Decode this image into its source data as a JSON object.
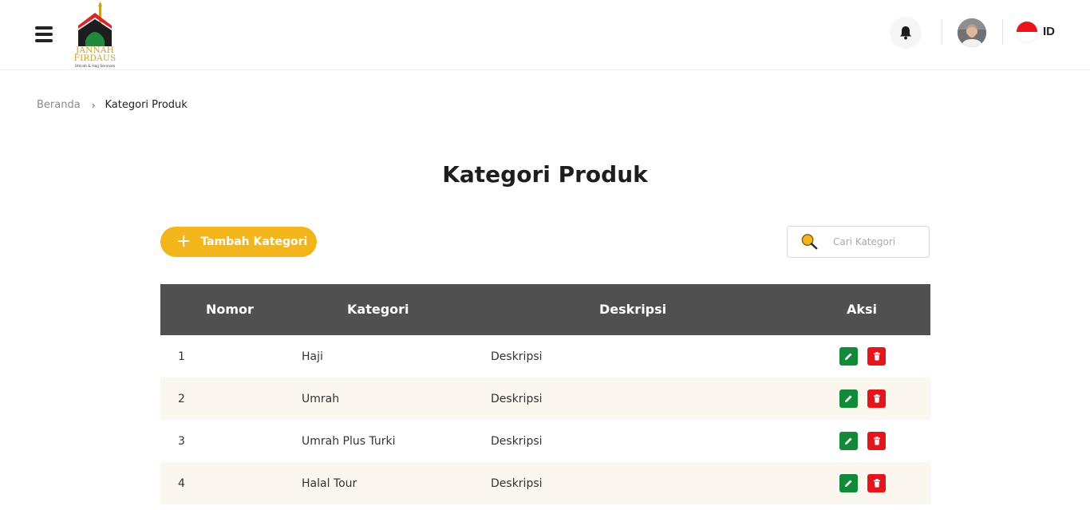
{
  "brand": {
    "name_line1": "JANNAH",
    "name_line2": "FIRDAUS",
    "tagline": "Umrah & Hajj Services"
  },
  "header": {
    "language": "ID"
  },
  "breadcrumb": {
    "home": "Beranda",
    "current": "Kategori Produk"
  },
  "page": {
    "title": "Kategori Produk"
  },
  "toolbar": {
    "add_label": "Tambah Kategori",
    "add_icon": "plus-icon",
    "search_placeholder": "Cari Kategori",
    "search_icon": "search-icon"
  },
  "table": {
    "columns": [
      "Nomor",
      "Kategori",
      "Deskripsi",
      "Aksi"
    ],
    "rows": [
      {
        "nomor": "1",
        "kategori": "Haji",
        "deskripsi": "Deskripsi"
      },
      {
        "nomor": "2",
        "kategori": "Umrah",
        "deskripsi": "Deskripsi"
      },
      {
        "nomor": "3",
        "kategori": "Umrah Plus Turki",
        "deskripsi": "Deskripsi"
      },
      {
        "nomor": "4",
        "kategori": "Halal Tour",
        "deskripsi": "Deskripsi"
      }
    ],
    "row_actions": [
      "edit-icon",
      "trash-icon"
    ]
  },
  "colors": {
    "accent": "#f2b51b",
    "header_bg": "#505050",
    "edit": "#138a3a",
    "delete": "#e3161e",
    "row_alt": "#fbf6ee",
    "brand_gold": "#c9a02a"
  }
}
